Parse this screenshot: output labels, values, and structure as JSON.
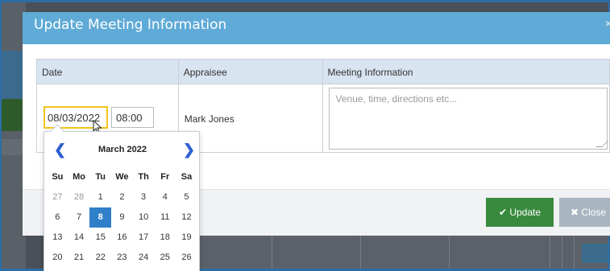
{
  "modal": {
    "title": "Update Meeting Information",
    "close_glyph": "×"
  },
  "table": {
    "headers": [
      "Date",
      "Appraisee",
      "Meeting Information"
    ],
    "row": {
      "date_value": "08/03/2022",
      "time_value": "08:00",
      "appraisee": "Mark Jones",
      "meeting_placeholder": "Venue, time, directions etc..."
    }
  },
  "datepicker": {
    "month_label": "March 2022",
    "prev_glyph": "❮",
    "next_glyph": "❯",
    "weekdays": [
      "Su",
      "Mo",
      "Tu",
      "We",
      "Th",
      "Fr",
      "Sa"
    ],
    "weeks": [
      [
        "27",
        "28",
        "1",
        "2",
        "3",
        "4",
        "5"
      ],
      [
        "6",
        "7",
        "8",
        "9",
        "10",
        "11",
        "12"
      ],
      [
        "13",
        "14",
        "15",
        "16",
        "17",
        "18",
        "19"
      ],
      [
        "20",
        "21",
        "22",
        "23",
        "24",
        "25",
        "26"
      ]
    ],
    "selected_day": "8",
    "accent_color": "#2f80c8"
  },
  "footer": {
    "update_label": "Update",
    "update_icon": "check-icon",
    "close_label": "Close",
    "close_icon": "times-icon"
  }
}
